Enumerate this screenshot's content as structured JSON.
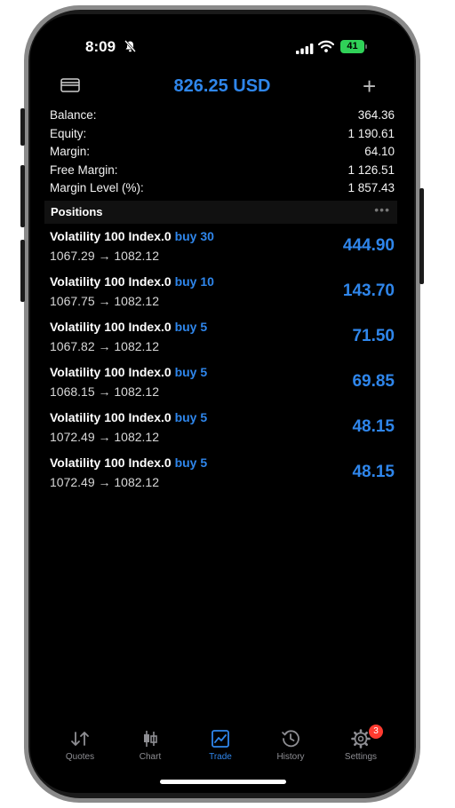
{
  "status_bar": {
    "time": "8:09",
    "battery": "41"
  },
  "header": {
    "title": "826.25 USD",
    "plus": "+"
  },
  "account": [
    {
      "label": "Balance:",
      "value": "364.36"
    },
    {
      "label": "Equity:",
      "value": "1 190.61"
    },
    {
      "label": "Margin:",
      "value": "64.10"
    },
    {
      "label": "Free Margin:",
      "value": "1 126.51"
    },
    {
      "label": "Margin Level (%):",
      "value": "1 857.43"
    }
  ],
  "positions": {
    "title": "Positions",
    "more": "•••",
    "items": [
      {
        "symbol": "Volatility 100 Index.0",
        "side": "buy 30",
        "prices": "1067.29 → 1082.12",
        "profit": "444.90"
      },
      {
        "symbol": "Volatility 100 Index.0",
        "side": "buy 10",
        "prices": "1067.75 → 1082.12",
        "profit": "143.70"
      },
      {
        "symbol": "Volatility 100 Index.0",
        "side": "buy 5",
        "prices": "1067.82 → 1082.12",
        "profit": "71.50"
      },
      {
        "symbol": "Volatility 100 Index.0",
        "side": "buy 5",
        "prices": "1068.15 → 1082.12",
        "profit": "69.85"
      },
      {
        "symbol": "Volatility 100 Index.0",
        "side": "buy 5",
        "prices": "1072.49 → 1082.12",
        "profit": "48.15"
      },
      {
        "symbol": "Volatility 100 Index.0",
        "side": "buy 5",
        "prices": "1072.49 → 1082.12",
        "profit": "48.15"
      }
    ]
  },
  "tabs": [
    {
      "label": "Quotes",
      "icon": "quotes-icon"
    },
    {
      "label": "Chart",
      "icon": "candlestick-icon"
    },
    {
      "label": "Trade",
      "icon": "trade-chart-icon",
      "active": true
    },
    {
      "label": "History",
      "icon": "history-icon"
    },
    {
      "label": "Settings",
      "icon": "gear-icon",
      "badge": "3"
    }
  ],
  "colors": {
    "accent": "#2f86eb",
    "background": "#000000",
    "badge": "#ff3b30",
    "battery": "#30d158"
  }
}
